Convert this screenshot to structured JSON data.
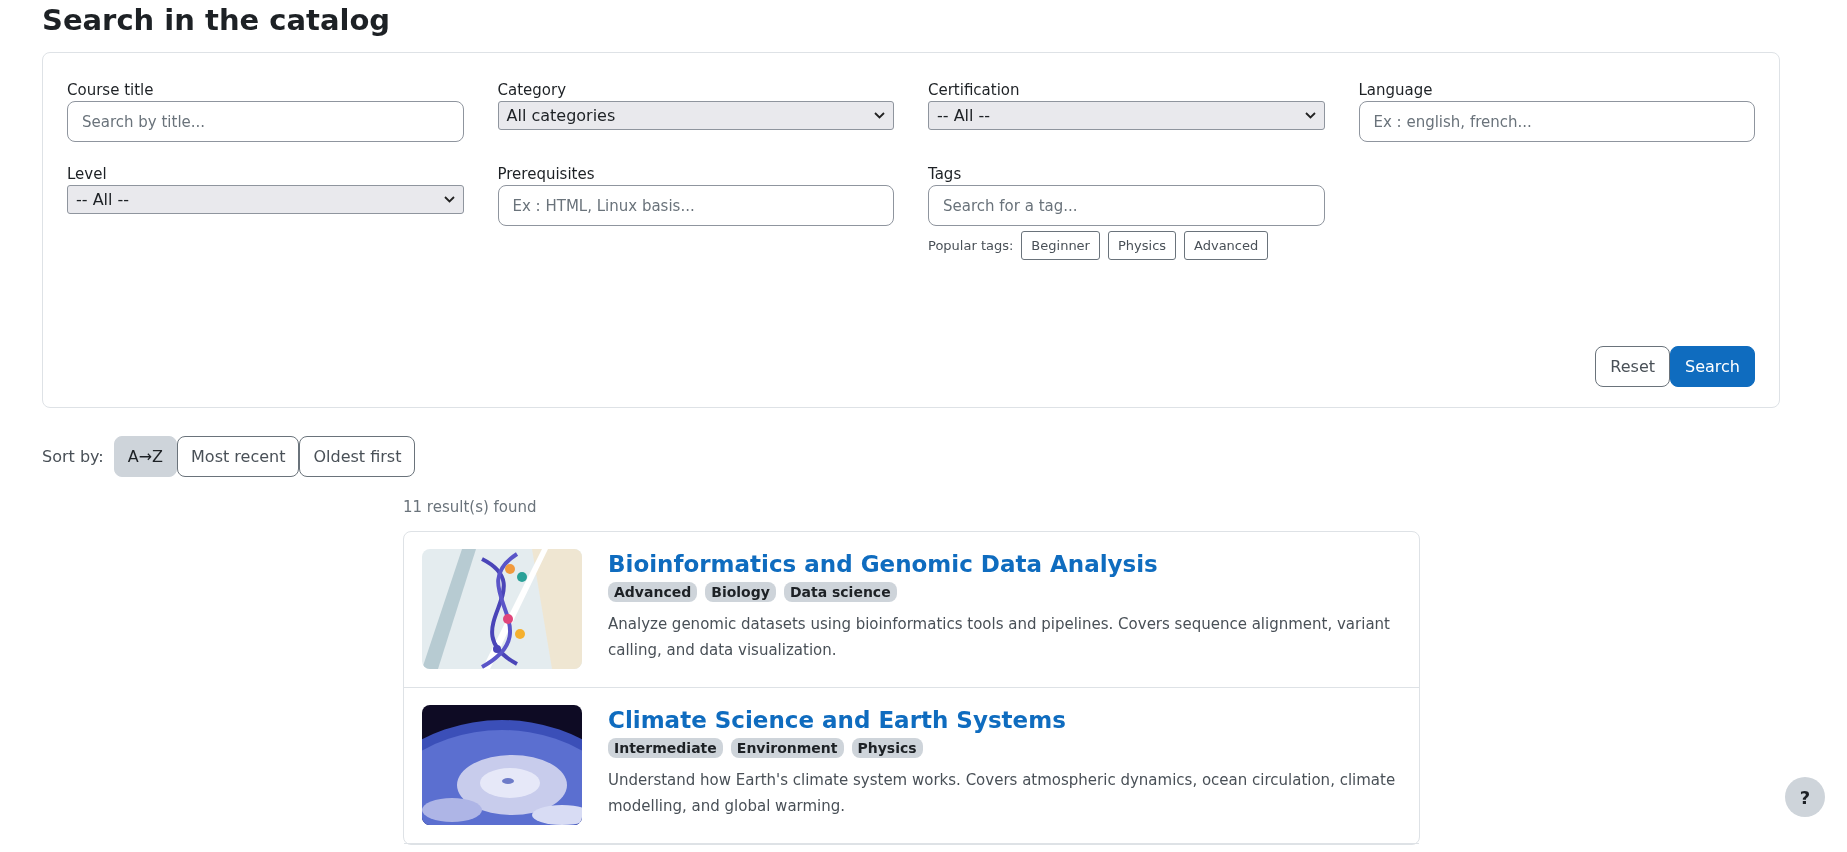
{
  "page_title": "Search in the catalog",
  "filters": [
    {
      "kind": "input",
      "label": "Course title",
      "placeholder": "Search by title..."
    },
    {
      "kind": "select",
      "label": "Category",
      "value": "All categories"
    },
    {
      "kind": "select",
      "label": "Certification",
      "value": "-- All --"
    },
    {
      "kind": "input",
      "label": "Language",
      "placeholder": "Ex : english, french..."
    },
    {
      "kind": "select",
      "label": "Level",
      "value": "-- All --"
    },
    {
      "kind": "input",
      "label": "Prerequisites",
      "placeholder": "Ex : HTML, Linux basis..."
    },
    {
      "kind": "input",
      "label": "Tags",
      "placeholder": "Search for a tag..."
    }
  ],
  "popular_tags": {
    "label": "Popular tags:",
    "tags": [
      "Beginner",
      "Physics",
      "Advanced"
    ]
  },
  "buttons": {
    "reset": "Reset",
    "search": "Search"
  },
  "sort": {
    "label": "Sort by:",
    "options": [
      {
        "label": "A→Z",
        "selected": true
      },
      {
        "label": "Most recent",
        "selected": false
      },
      {
        "label": "Oldest first",
        "selected": false
      }
    ]
  },
  "results_count": "11 result(s) found",
  "results": [
    {
      "title": "Bioinformatics and Genomic Data Analysis",
      "tags": [
        "Advanced",
        "Biology",
        "Data science"
      ],
      "description": "Analyze genomic datasets using bioinformatics tools and pipelines. Covers sequence alignment, variant calling, and data visualization."
    },
    {
      "title": "Climate Science and Earth Systems",
      "tags": [
        "Intermediate",
        "Environment",
        "Physics"
      ],
      "description": "Understand how Earth's climate system works. Covers atmospheric dynamics, ocean circulation, climate modelling, and global warming."
    }
  ],
  "help_button": "?"
}
